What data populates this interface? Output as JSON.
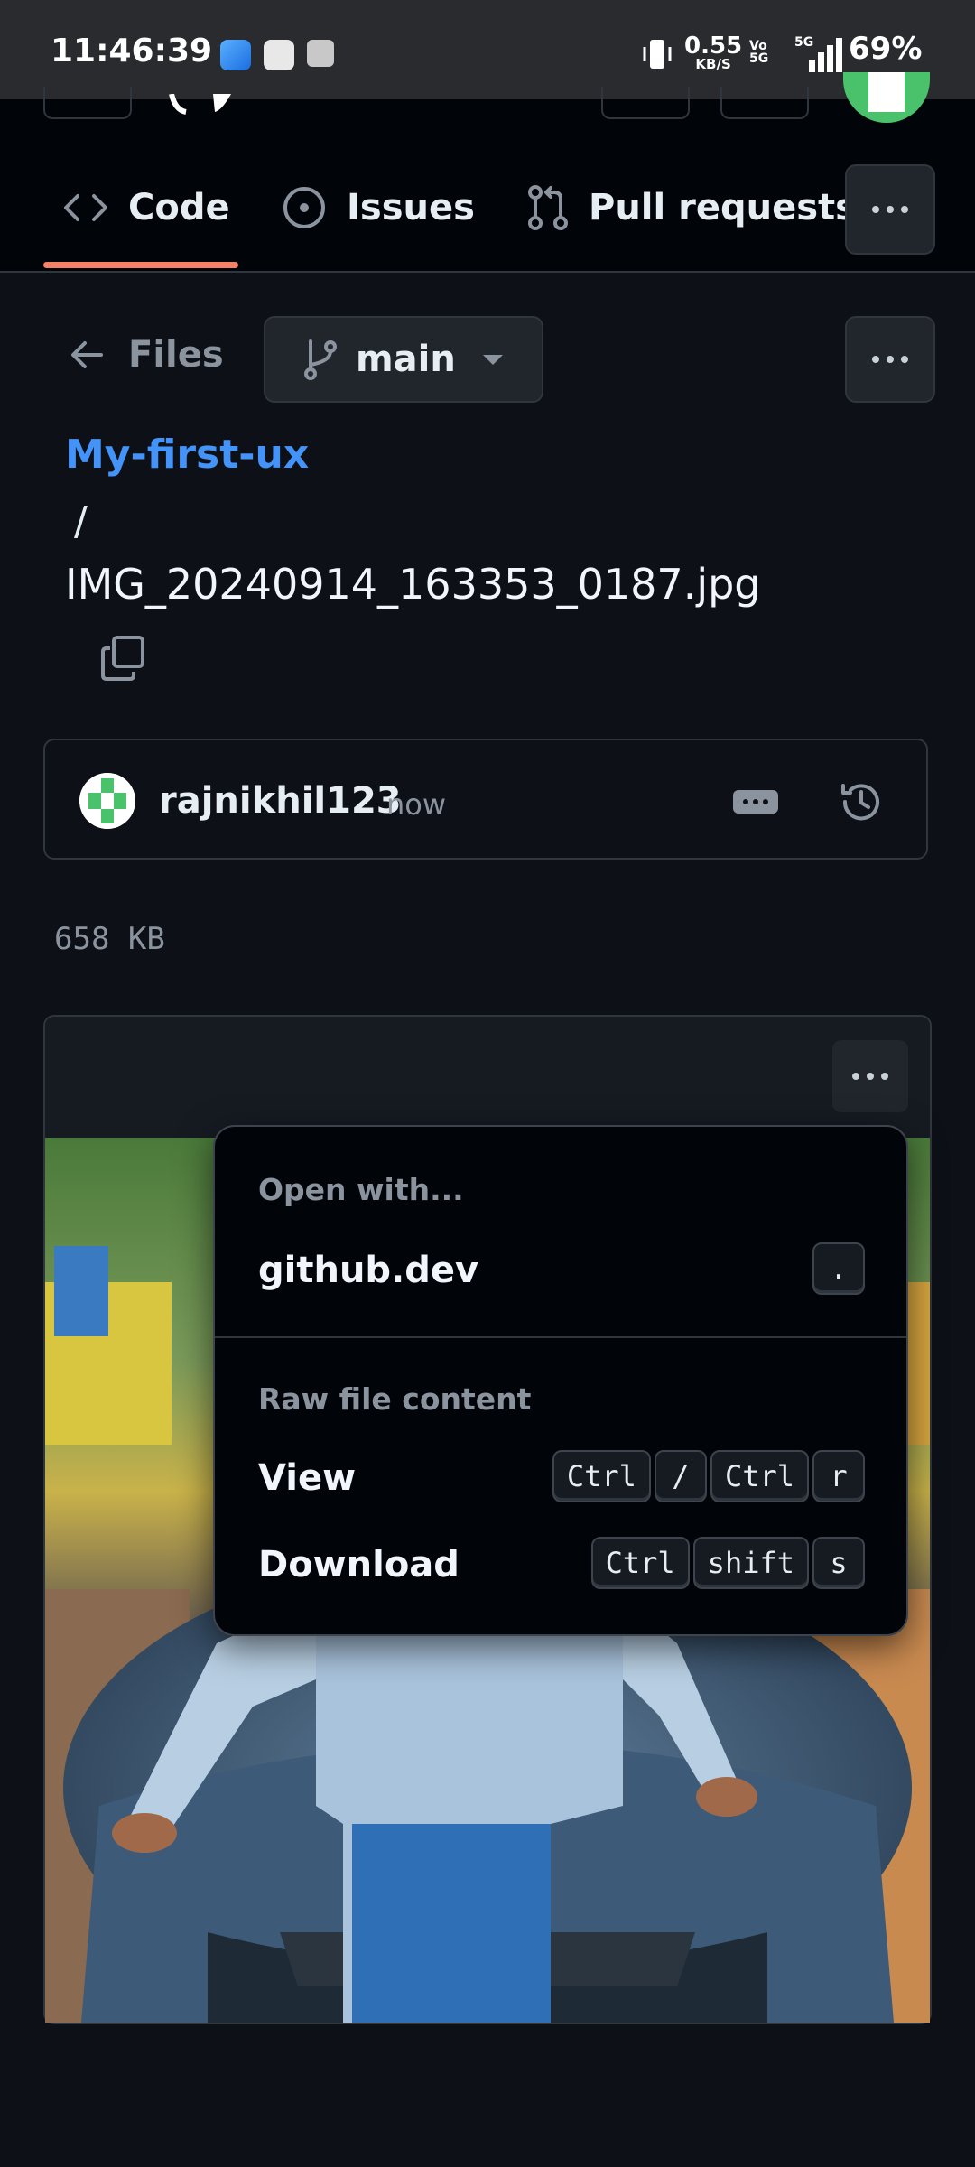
{
  "status_bar": {
    "time": "11:46:39",
    "net_speed": "0.55",
    "net_unit": "KB/S",
    "volte": "Vo 5G",
    "network": "5G",
    "battery": "69%"
  },
  "tabs": {
    "code": "Code",
    "issues": "Issues",
    "pulls": "Pull requests"
  },
  "nav": {
    "back_label": "Files",
    "branch": "main"
  },
  "path": {
    "repo": "My-first-ux",
    "separator": "/",
    "file": "IMG_20240914_163353_0187.jpg"
  },
  "commit": {
    "author": "rajnikhil123",
    "when": "now"
  },
  "file_size": "658 KB",
  "menu": {
    "open_with": "Open with...",
    "github_dev": "github.dev",
    "github_dev_key": ".",
    "raw_heading": "Raw file content",
    "view": "View",
    "view_keys": [
      "Ctrl",
      "/",
      "Ctrl",
      "r"
    ],
    "download": "Download",
    "download_keys": [
      "Ctrl",
      "shift",
      "s"
    ]
  },
  "colors": {
    "accent_link": "#4493f8",
    "tab_underline": "#f78166",
    "background": "#0d1117"
  }
}
